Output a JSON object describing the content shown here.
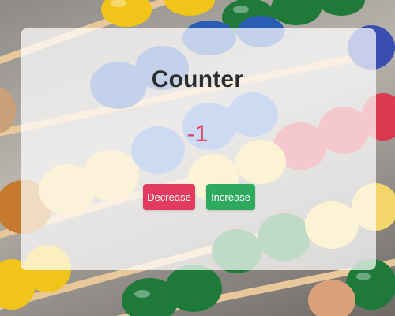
{
  "counter": {
    "title": "Counter",
    "value": "-1",
    "decrease_label": "Decrease",
    "increase_label": "Increase"
  },
  "colors": {
    "value_text": "#e0456a",
    "decrease_button": "#e23b5f",
    "increase_button": "#2eaa5e",
    "title_text": "#2d2d2d",
    "card_overlay": "rgba(255,255,255,0.72)"
  },
  "background": {
    "image": "abacus-photo"
  }
}
